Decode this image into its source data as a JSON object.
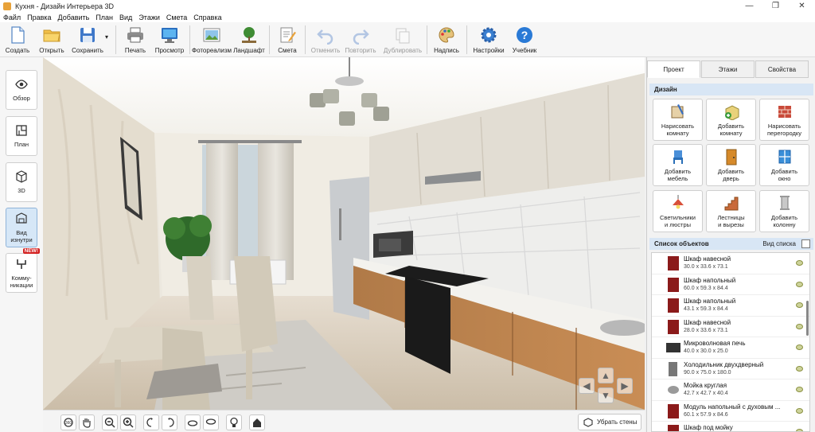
{
  "window": {
    "title": "Кухня - Дизайн Интерьера 3D",
    "controls": [
      "—",
      "❐",
      "✕"
    ]
  },
  "menu": [
    "Файл",
    "Правка",
    "Добавить",
    "План",
    "Вид",
    "Этажи",
    "Смета",
    "Справка"
  ],
  "toolbar": {
    "create": "Создать",
    "open": "Открыть",
    "save": "Сохранить",
    "save_arrow": "▾",
    "print": "Печать",
    "preview": "Просмотр",
    "photorealism": "Фотореализм",
    "landscape": "Ландшафт",
    "estimate": "Смета",
    "undo": "Отменить",
    "redo": "Повторить",
    "duplicate": "Дублировать",
    "caption": "Надпись",
    "settings": "Настройки",
    "tutorial": "Учебник"
  },
  "leftbar": {
    "overview": "Обзор",
    "plan": "План",
    "view3d": "3D",
    "inside_1": "Вид",
    "inside_2": "изнутри",
    "comm_1": "Комму-",
    "comm_2": "никации",
    "new_badge": "NEW!"
  },
  "bottombar": {
    "hide_walls": "Убрать стены"
  },
  "rightpanel": {
    "tabs": [
      "Проект",
      "Этажи",
      "Свойства"
    ],
    "design_header": "Дизайн",
    "design_buttons": [
      {
        "l1": "Нарисовать",
        "l2": "комнату"
      },
      {
        "l1": "Добавить",
        "l2": "комнату"
      },
      {
        "l1": "Нарисовать",
        "l2": "перегородку"
      },
      {
        "l1": "Добавить",
        "l2": "мебель"
      },
      {
        "l1": "Добавить",
        "l2": "дверь"
      },
      {
        "l1": "Добавить",
        "l2": "окно"
      },
      {
        "l1": "Светильники",
        "l2": "и люстры"
      },
      {
        "l1": "Лестницы",
        "l2": "и вырезы"
      },
      {
        "l1": "Добавить",
        "l2": "колонну"
      }
    ],
    "objects_header": "Список объектов",
    "list_view": "Вид списка",
    "objects": [
      {
        "name": "Шкаф навесной",
        "dims": "30.0 x 33.6 x 73.1",
        "color": "#8b1a1a"
      },
      {
        "name": "Шкаф напольный",
        "dims": "60.0 x 59.3 x 84.4",
        "color": "#8b1a1a"
      },
      {
        "name": "Шкаф напольный",
        "dims": "43.1 x 59.3 x 84.4",
        "color": "#8b1a1a"
      },
      {
        "name": "Шкаф навесной",
        "dims": "28.0 x 33.6 x 73.1",
        "color": "#8b1a1a"
      },
      {
        "name": "Микроволновая печь",
        "dims": "40.0 x 30.0 x 25.0",
        "color": "#333333"
      },
      {
        "name": "Холодильник двухдверный",
        "dims": "90.0 x 75.0 x 180.0",
        "color": "#777777"
      },
      {
        "name": "Мойка круглая",
        "dims": "42.7 x 42.7 x 40.4",
        "color": "#9a9a9a"
      },
      {
        "name": "Модуль напольный с духовым ...",
        "dims": "60.1 x 57.9 x 84.6",
        "color": "#8b1a1a"
      },
      {
        "name": "Шкаф под мойку",
        "dims": "",
        "color": "#8b1a1a"
      }
    ]
  }
}
